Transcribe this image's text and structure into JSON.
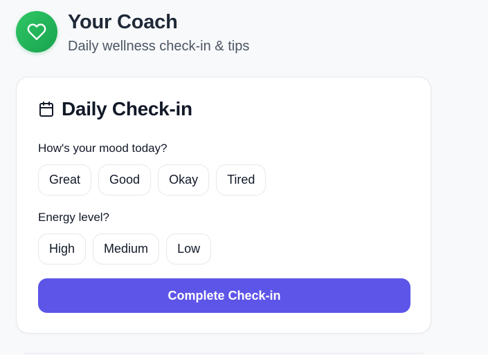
{
  "header": {
    "logo_icon": "heart-icon",
    "title": "Your Coach",
    "subtitle": "Daily wellness check-in & tips",
    "brand_color": "#22b35a"
  },
  "checkin": {
    "icon": "calendar-icon",
    "title": "Daily Check-in",
    "mood": {
      "question": "How's your mood today?",
      "options": [
        "Great",
        "Good",
        "Okay",
        "Tired"
      ]
    },
    "energy": {
      "question": "Energy level?",
      "options": [
        "High",
        "Medium",
        "Low"
      ]
    },
    "submit_label": "Complete Check-in",
    "accent_color": "#5d55e8"
  }
}
